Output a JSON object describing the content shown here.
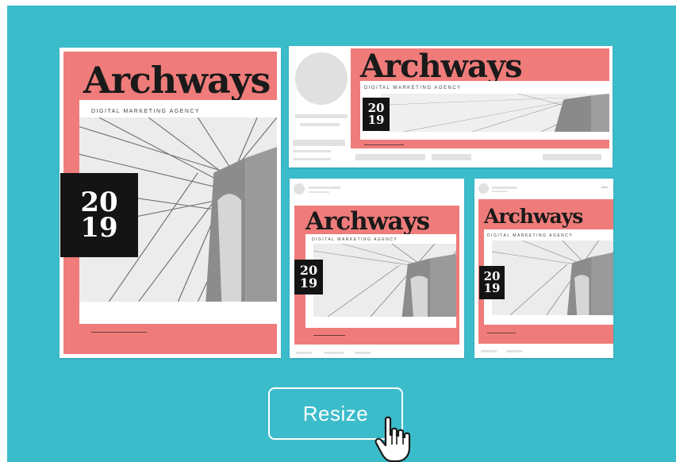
{
  "brand": {
    "title": "Archways",
    "tagline": "DIGITAL MARKETING AGENCY",
    "year_top": "20",
    "year_bottom": "19"
  },
  "colors": {
    "background": "#3bbccb",
    "accent": "#ef7c7a",
    "dark": "#141414"
  },
  "resize_button": {
    "label": "Resize"
  },
  "icons": {
    "cursor": "hand-pointer-icon"
  }
}
